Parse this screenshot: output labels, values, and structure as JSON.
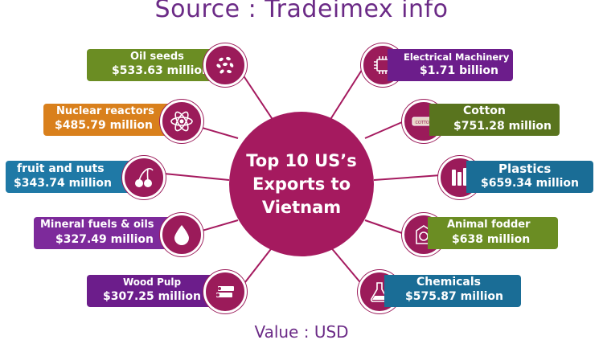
{
  "source_text": "Source : Tradeimex info",
  "center_text": "Top 10 US’s Exports to Vietnam",
  "footer_text": "Value : USD",
  "colors": {
    "center": "#a51a5f",
    "icon": "#9b1b5a",
    "connector": "#a51a5f"
  },
  "items": [
    {
      "label": "Oil seeds",
      "value": "$533.63 million",
      "color": "#6b8d23",
      "icon": "seeds-icon"
    },
    {
      "label": "Nuclear reactors",
      "value": "$485.79 million",
      "color": "#d9801c",
      "icon": "atom-icon"
    },
    {
      "label": "fruit and nuts",
      "value": "$343.74 million",
      "color": "#1f79a6",
      "icon": "cherry-icon"
    },
    {
      "label": "Mineral fuels & oils",
      "value": "$327.49 million",
      "color": "#7d2a9b",
      "icon": "drop-icon"
    },
    {
      "label": "Wood Pulp",
      "value": "$307.25 million",
      "color": "#6c1d8b",
      "icon": "logs-icon"
    },
    {
      "label": "Electrical Machinery",
      "value": "$1.71 billion",
      "color": "#6c1d8b",
      "icon": "chip-icon"
    },
    {
      "label": "Cotton",
      "value": "$751.28 million",
      "color": "#59741e",
      "icon": "cotton-bale-icon"
    },
    {
      "label": "Plastics",
      "value": "$659.34 million",
      "color": "#1a6d96",
      "icon": "plastics-icon"
    },
    {
      "label": "Animal fodder",
      "value": "$638 million",
      "color": "#6b8d23",
      "icon": "fodder-icon"
    },
    {
      "label": "Chemicals",
      "value": "$575.87 million",
      "color": "#1a6d96",
      "icon": "flask-icon"
    }
  ]
}
